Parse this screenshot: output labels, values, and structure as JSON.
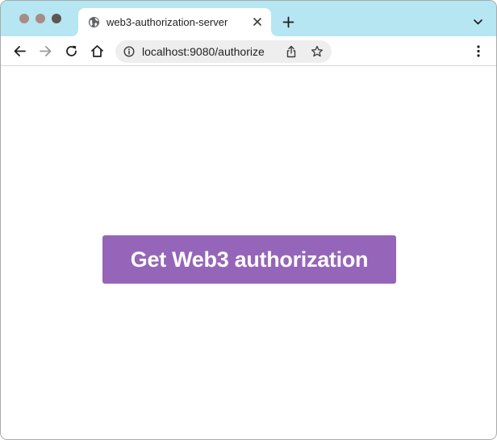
{
  "browser": {
    "traffic_lights": {
      "close_color": "#a88b86",
      "minimize_color": "#a88b86",
      "maximize_color": "#5c5552"
    },
    "tab": {
      "title": "web3-authorization-server",
      "favicon": "globe-icon",
      "close_icon": "close-icon"
    },
    "new_tab_icon": "plus-icon",
    "tab_list_icon": "chevron-down-icon",
    "toolbar": {
      "back_icon": "arrow-left-icon",
      "forward_icon": "arrow-right-icon",
      "reload_icon": "reload-icon",
      "home_icon": "home-icon",
      "menu_icon": "kebab-menu-icon"
    },
    "omnibox": {
      "site_info_icon": "info-icon",
      "url_host": "localhost:9080",
      "url_path": "/authorize",
      "share_icon": "share-icon",
      "bookmark_icon": "star-icon"
    },
    "colors": {
      "tab_strip": "#b6e6f2",
      "omnibox": "#eeeeee"
    }
  },
  "page": {
    "auth_button_label": "Get Web3 authorization",
    "auth_button_color": "#9565b9"
  }
}
